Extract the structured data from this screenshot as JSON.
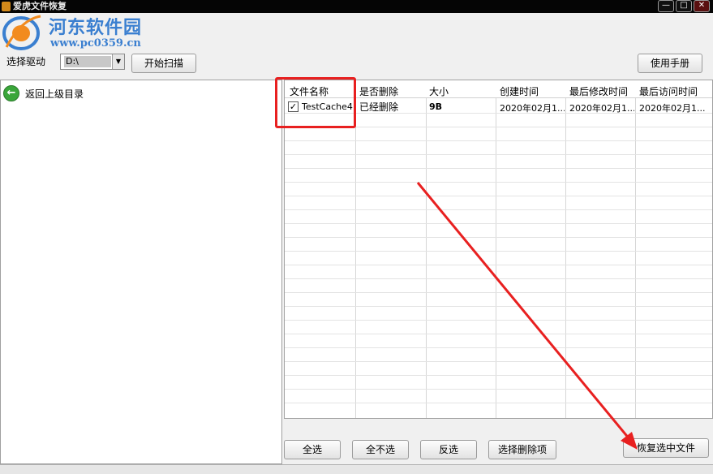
{
  "window": {
    "title": "爱虎文件恢复",
    "controls": {
      "minimize": "—",
      "maximize": "□",
      "close": "✕"
    }
  },
  "watermark": {
    "title": "河东软件园",
    "url": "www.pc0359.cn"
  },
  "toolbar": {
    "drive_label": "选择驱动",
    "drive_value": "D:\\",
    "scan_button": "开始扫描",
    "manual_button": "使用手册"
  },
  "left_panel": {
    "back_label": "返回上级目录"
  },
  "table": {
    "columns": [
      "文件名称",
      "是否删除",
      "大小",
      "创建时间",
      "最后修改时间",
      "最后访问时间"
    ],
    "rows": [
      {
        "checked": true,
        "name": "TestCache4...",
        "deleted": "已经删除",
        "size": "9B",
        "created": "2020年02月1...",
        "modified": "2020年02月1...",
        "accessed": "2020年02月1..."
      }
    ]
  },
  "actions": {
    "select_all": "全选",
    "select_none": "全不选",
    "invert": "反选",
    "select_deleted": "选择删除项",
    "recover": "恢复选中文件"
  },
  "colors": {
    "annotation": "#e82020",
    "watermark": "#3a7fd0"
  }
}
